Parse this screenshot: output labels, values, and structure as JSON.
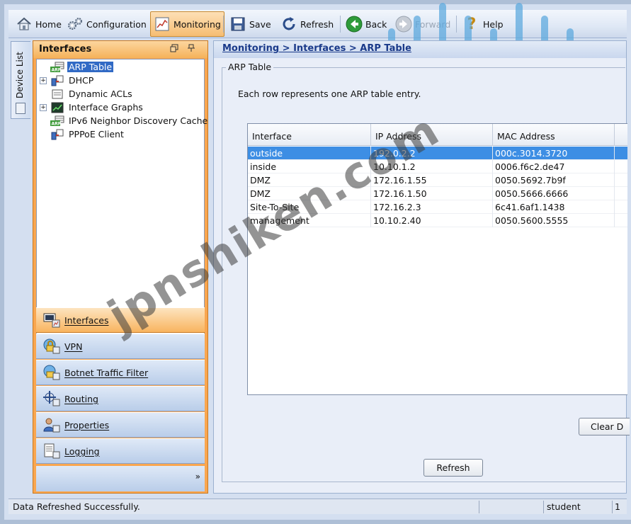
{
  "toolbar": {
    "home": "Home",
    "configuration": "Configuration",
    "monitoring": "Monitoring",
    "save": "Save",
    "refresh": "Refresh",
    "back": "Back",
    "forward": "Forward",
    "help": "Help"
  },
  "brand": {
    "logo_text": "CISCO",
    "color": "#5aa8de"
  },
  "device_list_tab": {
    "label": "Device List"
  },
  "left_panel": {
    "title": "Interfaces",
    "tree": [
      {
        "label": "ARP Table",
        "icon": "arp-icon",
        "expandable": false,
        "selected": true
      },
      {
        "label": "DHCP",
        "icon": "dhcp-icon",
        "expandable": true
      },
      {
        "label": "Dynamic ACLs",
        "icon": "acl-icon",
        "expandable": false
      },
      {
        "label": "Interface Graphs",
        "icon": "graph-icon",
        "expandable": true
      },
      {
        "label": "IPv6 Neighbor Discovery Cache",
        "icon": "arp-icon",
        "expandable": false
      },
      {
        "label": "PPPoE Client",
        "icon": "pppoe-icon",
        "expandable": false
      }
    ],
    "nav": [
      {
        "label": "Interfaces",
        "active": true
      },
      {
        "label": "VPN"
      },
      {
        "label": "Botnet Traffic Filter"
      },
      {
        "label": "Routing"
      },
      {
        "label": "Properties"
      },
      {
        "label": "Logging"
      }
    ],
    "more": "»"
  },
  "content": {
    "breadcrumb": "Monitoring > Interfaces > ARP Table",
    "group_title": "ARP Table",
    "description": "Each row represents one ARP table entry.",
    "table": {
      "columns": [
        "Interface",
        "IP Address",
        "MAC Address"
      ],
      "rows": [
        [
          "outside",
          "192.0.2.2",
          "000c.3014.3720"
        ],
        [
          "inside",
          "10.10.1.2",
          "0006.f6c2.de47"
        ],
        [
          "DMZ",
          "172.16.1.55",
          "0050.5692.7b9f"
        ],
        [
          "DMZ",
          "172.16.1.50",
          "0050.5666.6666"
        ],
        [
          "Site-To-Site",
          "172.16.2.3",
          "6c41.6af1.1438"
        ],
        [
          "management",
          "10.10.2.40",
          "0050.5600.5555"
        ]
      ],
      "selected_row": 0
    },
    "clear_button": "Clear D",
    "refresh_button": "Refresh"
  },
  "status_bar": {
    "message": "Data Refreshed Successfully.",
    "user": "student",
    "extra": "1"
  },
  "watermark": "jpnshiken.com"
}
